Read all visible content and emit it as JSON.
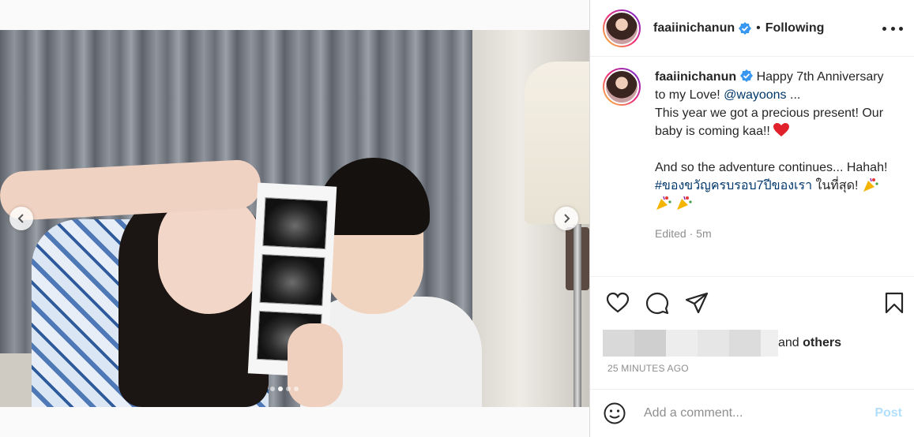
{
  "post": {
    "username": "faaiinichanun",
    "follow_separator": "•",
    "follow_status": "Following",
    "caption_lines": [
      "Happy 7th Anniversary to my Love!",
      "@wayoons",
      "...",
      "This year we got a precious present! Our baby is coming kaa!!",
      "And so the adventure continues... Hahah!",
      "#ของขวัญครบรอบ7ปีของเรา",
      "ในที่สุด!"
    ],
    "edited": "Edited",
    "edited_time": "5m",
    "likes_suffix_and": "and",
    "likes_suffix_others": "others",
    "timestamp": "25 MINUTES AGO",
    "comment_placeholder": "Add a comment...",
    "post_label": "Post"
  },
  "carousel": {
    "dot_count": 4,
    "active_dot": 1
  },
  "colors": {
    "link": "#00376b",
    "verified": "#3897f0",
    "post_disabled": "#b2dffc",
    "heart": "#ed4956"
  },
  "icons": [
    "verified-badge-icon",
    "more-options-icon",
    "like-icon",
    "comment-icon",
    "share-icon",
    "save-icon",
    "emoji-icon",
    "carousel-prev-icon",
    "carousel-next-icon",
    "heart-emoji-icon",
    "party-popper-icon"
  ]
}
